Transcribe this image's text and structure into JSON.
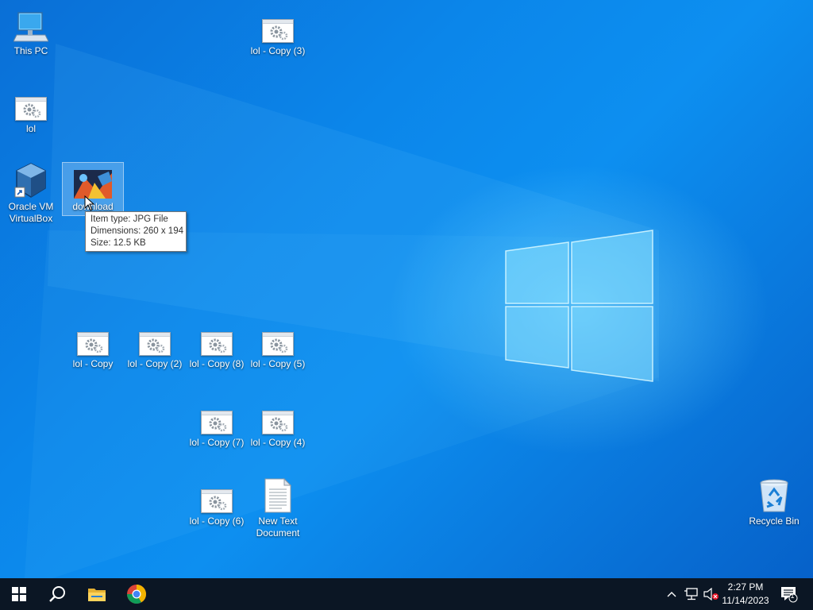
{
  "desktop": {
    "icons": [
      {
        "label": "This PC",
        "icon": "computer-icon"
      },
      {
        "label": "lol - Copy (3)",
        "icon": "gear-shortcut-icon"
      },
      {
        "label": "lol",
        "icon": "gear-shortcut-icon"
      },
      {
        "label": "Oracle VM VirtualBox",
        "icon": "virtualbox-icon"
      },
      {
        "label": "download",
        "icon": "image-file-icon"
      },
      {
        "label": "lol - Copy",
        "icon": "gear-shortcut-icon"
      },
      {
        "label": "lol - Copy (2)",
        "icon": "gear-shortcut-icon"
      },
      {
        "label": "lol - Copy (8)",
        "icon": "gear-shortcut-icon"
      },
      {
        "label": "lol - Copy (5)",
        "icon": "gear-shortcut-icon"
      },
      {
        "label": "lol - Copy (7)",
        "icon": "gear-shortcut-icon"
      },
      {
        "label": "lol - Copy (4)",
        "icon": "gear-shortcut-icon"
      },
      {
        "label": "lol - Copy (6)",
        "icon": "gear-shortcut-icon"
      },
      {
        "label": "New Text Document",
        "icon": "text-document-icon"
      },
      {
        "label": "Recycle Bin",
        "icon": "recycle-bin-icon"
      }
    ]
  },
  "tooltip": {
    "item_type": "Item type: JPG File",
    "dimensions": "Dimensions: 260 x 194",
    "size": "Size: 12.5 KB"
  },
  "taskbar": {
    "pinned": [
      {
        "name": "start-button",
        "icon": "windows-logo-icon"
      },
      {
        "name": "search-button",
        "icon": "search-icon"
      },
      {
        "name": "file-explorer-button",
        "icon": "folder-icon"
      },
      {
        "name": "chrome-button",
        "icon": "chrome-icon"
      }
    ],
    "time": "2:27 PM",
    "date": "11/14/2023",
    "notification_count": "1"
  },
  "colors": {
    "wallpaper": "#0b86ea",
    "taskbar": "#0b1624",
    "selection": "#cce8ff"
  }
}
